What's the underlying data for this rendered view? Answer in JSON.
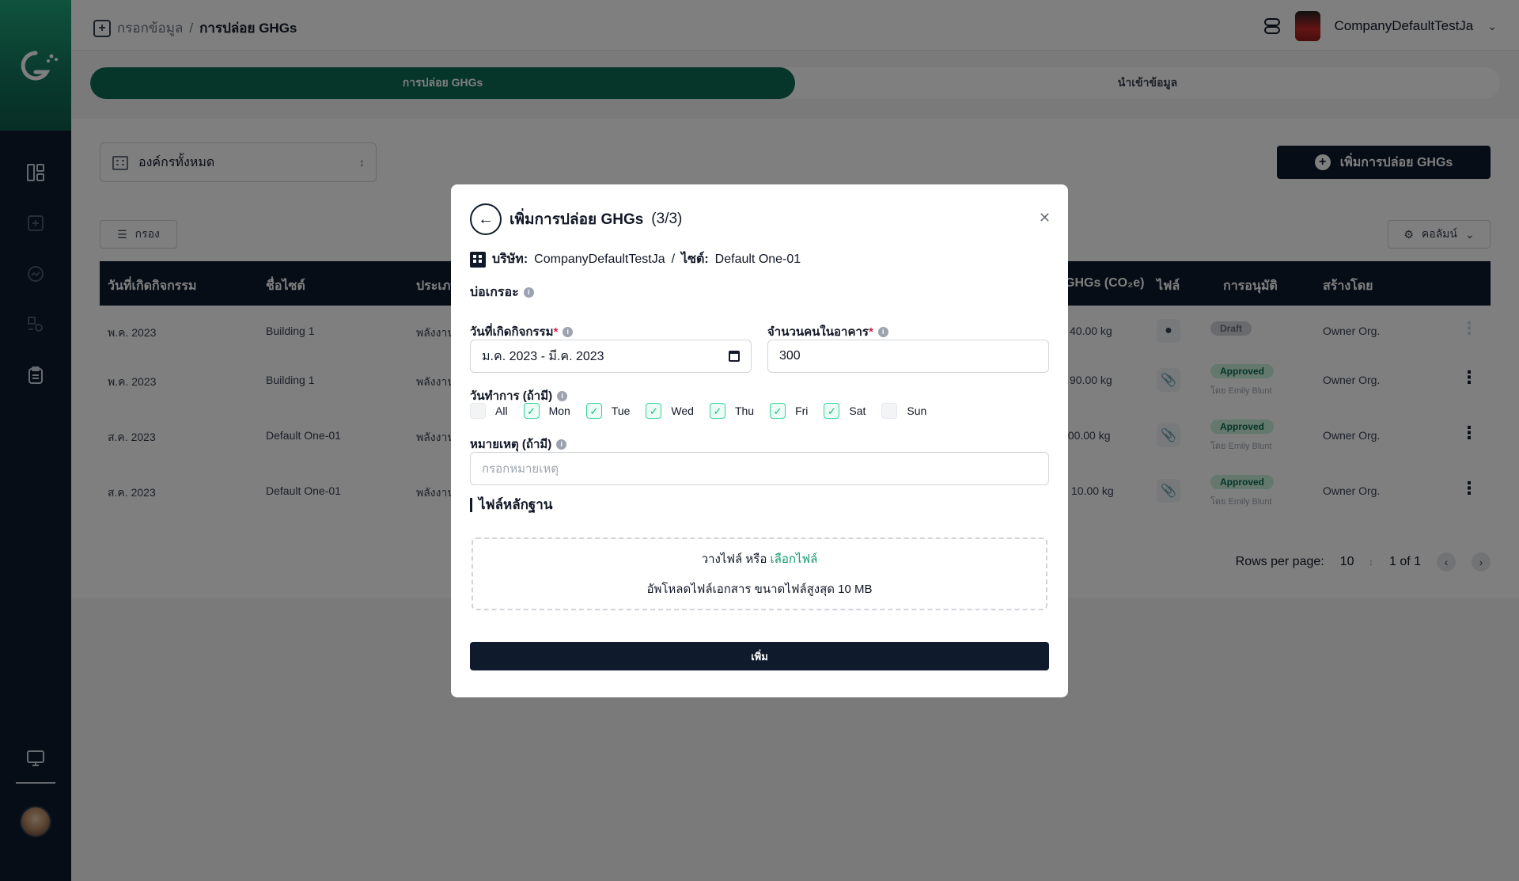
{
  "breadcrumb": {
    "parent": "กรอกข้อมูล",
    "separator": "/",
    "current": "การปล่อย GHGs"
  },
  "user": {
    "company_name": "CompanyDefaultTestJa"
  },
  "tabs": [
    {
      "label": "การปล่อย GHGs"
    },
    {
      "label": "นำเข้าข้อมูล"
    }
  ],
  "toolbar": {
    "org_select": "องค์กรทั้งหมด",
    "add_button": "เพิ่มการปล่อย GHGs",
    "filter_button": "กรอง",
    "column_button": "คอลัมน์"
  },
  "table": {
    "headers": [
      "วันที่เกิดกิจกรรม",
      "ชื่อไซต์",
      "ประเภท",
      "GHGs (CO₂e)",
      "ไฟล์",
      "การอนุมัติ",
      "สร้างโดย"
    ],
    "rows": [
      {
        "date": "พ.ค. 2023",
        "site": "Building 1",
        "type": "พลังงาน",
        "ghg": "40.00 kg",
        "approval": "Draft",
        "approver": "",
        "created_by": "Owner Org."
      },
      {
        "date": "พ.ค. 2023",
        "site": "Building 1",
        "type": "พลังงาน",
        "ghg": "90.00 kg",
        "approval": "Approved",
        "approver": "โดย Emily Blunt",
        "created_by": "Owner Org."
      },
      {
        "date": "ส.ค. 2023",
        "site": "Default One-01",
        "type": "พลังงาน",
        "ghg": "400.00 kg",
        "approval": "Approved",
        "approver": "โดย Emily Blunt",
        "created_by": "Owner Org."
      },
      {
        "date": "ส.ค. 2023",
        "site": "Default One-01",
        "type": "พลังงาน",
        "ghg": "10.00 kg",
        "approval": "Approved",
        "approver": "โดย Emily Blunt",
        "created_by": "Owner Org."
      }
    ]
  },
  "pagination": {
    "rows_label": "Rows per page:",
    "rows_value": "10",
    "range": "1 of 1"
  },
  "modal": {
    "title": "เพิ่มการปล่อย GHGs",
    "step": "(3/3)",
    "company_label": "บริษัท:",
    "company_value": "CompanyDefaultTestJa",
    "site_label": "ไซต์:",
    "site_value": "Default One-01",
    "section_title": "บ่อเกรอะ",
    "date_label": "วันที่เกิดกิจกรรม",
    "date_value": "ม.ค. 2023 - มี.ค. 2023",
    "people_label": "จำนวนคนในอาคาร",
    "people_value": "300",
    "workdays_label": "วันทำการ (ถ้ามี)",
    "days": [
      {
        "label": "All",
        "checked": false
      },
      {
        "label": "Mon",
        "checked": true
      },
      {
        "label": "Tue",
        "checked": true
      },
      {
        "label": "Wed",
        "checked": true
      },
      {
        "label": "Thu",
        "checked": true
      },
      {
        "label": "Fri",
        "checked": true
      },
      {
        "label": "Sat",
        "checked": true
      },
      {
        "label": "Sun",
        "checked": false
      }
    ],
    "note_label": "หมายเหตุ (ถ้ามี)",
    "note_placeholder": "กรอกหมายเหตุ",
    "evidence_title": "ไฟล์หลักฐาน",
    "dropzone_text": "วางไฟล์ หรือ",
    "dropzone_link": "เลือกไฟล์",
    "dropzone_hint": "อัพโหลดไฟล์เอกสาร ขนาดไฟล์สูงสุด 10 MB",
    "submit_label": "เพิ่ม"
  },
  "colors": {
    "brand_green": "#0c6b52",
    "navy": "#0f1b2d",
    "link_green": "#0c9a6e",
    "required": "#e11d48"
  }
}
